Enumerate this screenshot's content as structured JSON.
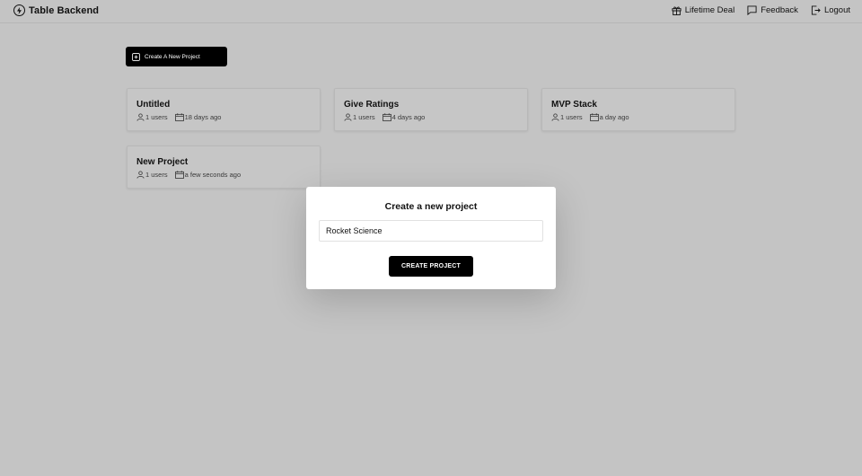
{
  "brand": {
    "name": "Table Backend",
    "icon": "bolt-circle-icon"
  },
  "nav": [
    {
      "label": "Lifetime Deal",
      "icon": "gift-icon"
    },
    {
      "label": "Feedback",
      "icon": "message-icon"
    },
    {
      "label": "Logout",
      "icon": "logout-icon"
    }
  ],
  "create_button": {
    "label": "Create A New Project",
    "icon": "plus-square-icon"
  },
  "projects": [
    {
      "name": "Untitled",
      "users": "1 users",
      "updated": "18 days ago"
    },
    {
      "name": "Give Ratings",
      "users": "1 users",
      "updated": "4 days ago"
    },
    {
      "name": "MVP Stack",
      "users": "1 users",
      "updated": "a day ago"
    },
    {
      "name": "New Project",
      "users": "1 users",
      "updated": "a few seconds ago"
    }
  ],
  "modal": {
    "title": "Create a new project",
    "input_value": "Rocket Science",
    "submit_label": "CREATE PROJECT"
  },
  "colors": {
    "background": "#c4c4c4",
    "button": "#000000",
    "modal": "#ffffff"
  }
}
